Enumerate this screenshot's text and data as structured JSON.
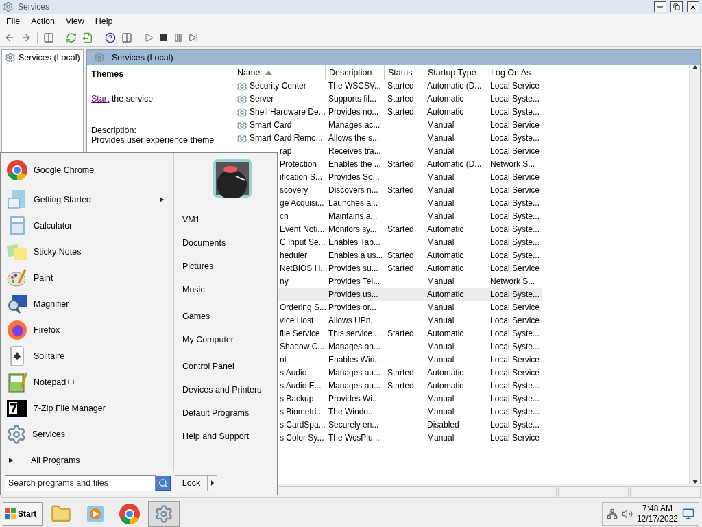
{
  "window": {
    "title": "Services"
  },
  "menu": [
    "File",
    "Action",
    "View",
    "Help"
  ],
  "tree": {
    "label": "Services (Local)"
  },
  "panel": {
    "title": "Services (Local)",
    "service_name": "Themes",
    "action_link": "Start",
    "action_text": " the service",
    "description_label": "Description:",
    "description": "Provides user experience theme"
  },
  "table": {
    "columns": [
      {
        "label": "Name",
        "sorted": true
      },
      {
        "label": "Description",
        "sorted": false
      },
      {
        "label": "Status",
        "sorted": false
      },
      {
        "label": "Startup Type",
        "sorted": false
      },
      {
        "label": "Log On As",
        "sorted": false
      }
    ],
    "rows": [
      {
        "kind": "full",
        "selected": false,
        "name": "Security Center",
        "description": "The WSCSV...",
        "status": "Started",
        "startup": "Automatic (D...",
        "logon": "Local Service"
      },
      {
        "kind": "full",
        "selected": false,
        "name": "Server",
        "description": "Supports fil...",
        "status": "Started",
        "startup": "Automatic",
        "logon": "Local Syste..."
      },
      {
        "kind": "full",
        "selected": false,
        "name": "Shell Hardware De...",
        "description": "Provides no...",
        "status": "Started",
        "startup": "Automatic",
        "logon": "Local Syste..."
      },
      {
        "kind": "full",
        "selected": false,
        "name": "Smart Card",
        "description": "Manages ac...",
        "startup": "Manual",
        "logon": "Local Service"
      },
      {
        "kind": "full",
        "selected": false,
        "name": "Smart Card Remo...",
        "description": "Allows the s...",
        "startup": "Manual",
        "logon": "Local Syste..."
      },
      {
        "kind": "covered",
        "selected": false,
        "name": "rap",
        "description": "Receives tra...",
        "startup": "Manual",
        "logon": "Local Service"
      },
      {
        "kind": "covered",
        "selected": false,
        "name": "Protection",
        "description": "Enables the ...",
        "status": "Started",
        "startup": "Automatic (D...",
        "logon": "Network S..."
      },
      {
        "kind": "covered",
        "selected": false,
        "name": "ification S...",
        "description": "Provides So...",
        "startup": "Manual",
        "logon": "Local Service"
      },
      {
        "kind": "covered",
        "selected": false,
        "name": "scovery",
        "description": "Discovers n...",
        "status": "Started",
        "startup": "Manual",
        "logon": "Local Service"
      },
      {
        "kind": "covered",
        "selected": false,
        "name": "ge Acquisi...",
        "description": "Launches a...",
        "startup": "Manual",
        "logon": "Local Syste..."
      },
      {
        "kind": "covered",
        "selected": false,
        "name": "ch",
        "description": "Maintains a...",
        "startup": "Manual",
        "logon": "Local Syste..."
      },
      {
        "kind": "covered",
        "selected": false,
        "name": "Event Noti...",
        "description": "Monitors sy...",
        "status": "Started",
        "startup": "Automatic",
        "logon": "Local Syste..."
      },
      {
        "kind": "covered",
        "selected": false,
        "name": "C Input Se...",
        "description": "Enables Tab...",
        "startup": "Manual",
        "logon": "Local Syste..."
      },
      {
        "kind": "covered",
        "selected": false,
        "name": "heduler",
        "description": "Enables a us...",
        "status": "Started",
        "startup": "Automatic",
        "logon": "Local Syste..."
      },
      {
        "kind": "covered",
        "selected": false,
        "name": "NetBIOS H...",
        "description": "Provides su...",
        "status": "Started",
        "startup": "Automatic",
        "logon": "Local Service"
      },
      {
        "kind": "covered",
        "selected": false,
        "name": "ny",
        "description": "Provides Tel...",
        "startup": "Manual",
        "logon": "Network S..."
      },
      {
        "kind": "covered",
        "selected": true,
        "description": "Provides us...",
        "startup": "Automatic",
        "logon": "Local Syste..."
      },
      {
        "kind": "covered",
        "selected": false,
        "name": "Ordering S...",
        "description": "Provides or...",
        "startup": "Manual",
        "logon": "Local Service"
      },
      {
        "kind": "covered",
        "selected": false,
        "name": "vice Host",
        "description": "Allows UPn...",
        "startup": "Manual",
        "logon": "Local Service"
      },
      {
        "kind": "covered",
        "selected": false,
        "name": "file Service",
        "description": "This service ...",
        "status": "Started",
        "startup": "Automatic",
        "logon": "Local Syste..."
      },
      {
        "kind": "covered",
        "selected": false,
        "name": "Shadow C...",
        "description": "Manages an...",
        "startup": "Manual",
        "logon": "Local Syste..."
      },
      {
        "kind": "covered",
        "selected": false,
        "name": "nt",
        "description": "Enables Win...",
        "startup": "Manual",
        "logon": "Local Service"
      },
      {
        "kind": "covered",
        "selected": false,
        "name": "s Audio",
        "description": "Manages au...",
        "status": "Started",
        "startup": "Automatic",
        "logon": "Local Service"
      },
      {
        "kind": "covered",
        "selected": false,
        "name": "s Audio E...",
        "description": "Manages au...",
        "status": "Started",
        "startup": "Automatic",
        "logon": "Local Syste..."
      },
      {
        "kind": "covered",
        "selected": false,
        "name": "s Backup",
        "description": "Provides Wi...",
        "startup": "Manual",
        "logon": "Local Syste..."
      },
      {
        "kind": "covered",
        "selected": false,
        "name": "s Biometri...",
        "description": "The Windo...",
        "startup": "Manual",
        "logon": "Local Syste..."
      },
      {
        "kind": "covered",
        "selected": false,
        "name": "s CardSpa...",
        "description": "Securely en...",
        "startup": "Disabled",
        "logon": "Local Syste..."
      },
      {
        "kind": "covered",
        "selected": false,
        "name": "s Color Sy...",
        "description": "The WcsPlu...",
        "startup": "Manual",
        "logon": "Local Service"
      }
    ]
  },
  "start_menu": {
    "pinned": [
      {
        "label": "Google Chrome",
        "submenu": false
      }
    ],
    "recent": [
      {
        "label": "Getting Started",
        "submenu": true
      },
      {
        "label": "Calculator",
        "submenu": false
      },
      {
        "label": "Sticky Notes",
        "submenu": false
      },
      {
        "label": "Paint",
        "submenu": false
      },
      {
        "label": "Magnifier",
        "submenu": false
      },
      {
        "label": "Firefox",
        "submenu": false
      },
      {
        "label": "Solitaire",
        "submenu": false
      },
      {
        "label": "Notepad++",
        "submenu": false
      },
      {
        "label": "7-Zip File Manager",
        "submenu": false
      },
      {
        "label": "Services",
        "submenu": false
      }
    ],
    "all_programs": "All Programs",
    "places": [
      [
        "VM1",
        "Documents",
        "Pictures",
        "Music"
      ],
      [
        "Games",
        "My Computer"
      ],
      [
        "Control Panel",
        "Devices and Printers",
        "Default Programs",
        "Help and Support"
      ]
    ],
    "search": {
      "placeholder": "Search programs and files"
    },
    "lock": "Lock"
  },
  "taskbar": {
    "start": "Start",
    "apps": [
      {
        "active": false
      },
      {
        "active": false
      },
      {
        "active": false
      },
      {
        "active": true
      }
    ],
    "time": "7:48 AM",
    "date": "12/17/2022"
  }
}
